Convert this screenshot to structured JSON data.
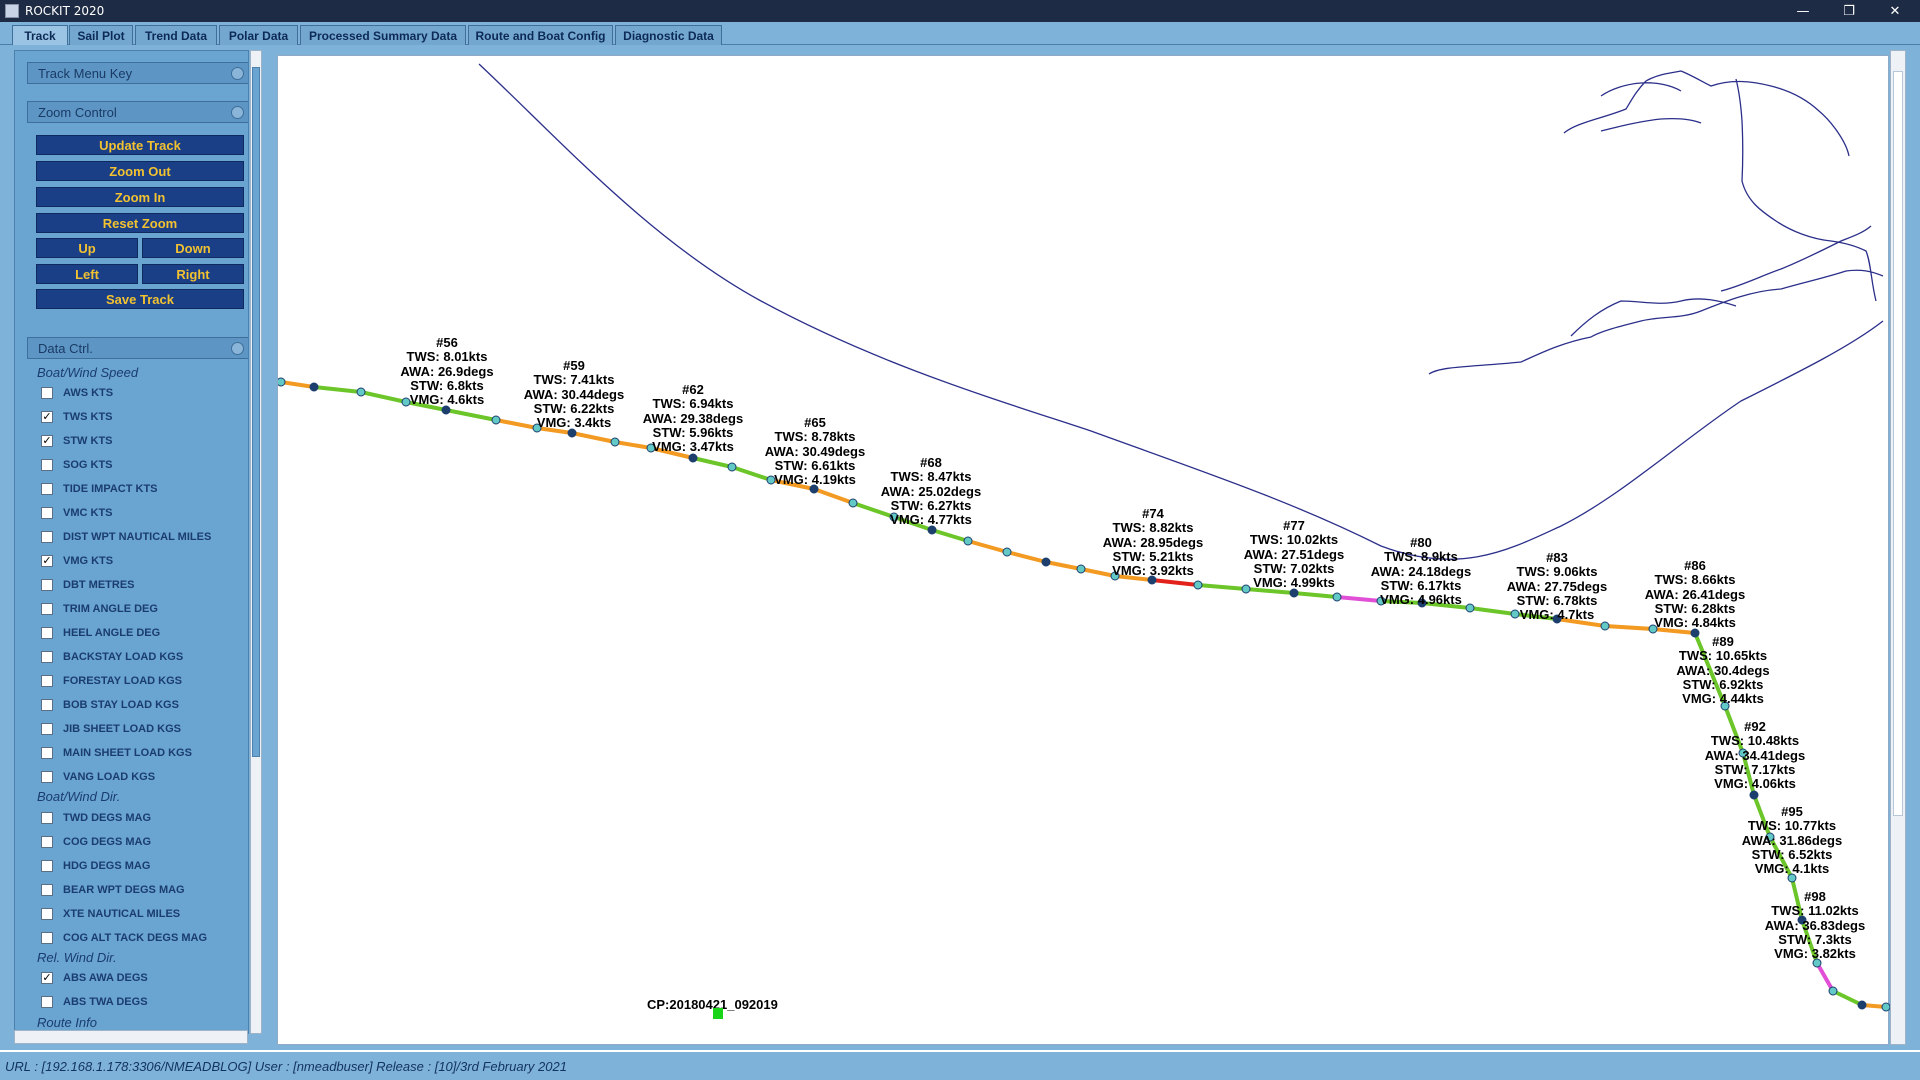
{
  "window": {
    "title": "ROCKIT 2020"
  },
  "tabs": [
    {
      "label": "Track",
      "active": true
    },
    {
      "label": "Sail Plot"
    },
    {
      "label": "Trend Data"
    },
    {
      "label": "Polar Data"
    },
    {
      "label": "Processed Summary Data"
    },
    {
      "label": "Route and Boat Config"
    },
    {
      "label": "Diagnostic Data"
    }
  ],
  "sidebar": {
    "track_menu_key": "Track Menu Key",
    "zoom_control": {
      "title": "Zoom Control",
      "update_track": "Update Track",
      "zoom_out": "Zoom Out",
      "zoom_in": "Zoom In",
      "reset_zoom": "Reset Zoom",
      "up": "Up",
      "down": "Down",
      "left": "Left",
      "right": "Right",
      "save_track": "Save Track"
    },
    "data_ctrl": {
      "title": "Data Ctrl.",
      "categories": [
        {
          "label": "Boat/Wind Speed",
          "items": [
            {
              "label": "AWS KTS",
              "checked": false
            },
            {
              "label": "TWS KTS",
              "checked": true
            },
            {
              "label": "STW KTS",
              "checked": true
            },
            {
              "label": "SOG KTS",
              "checked": false
            },
            {
              "label": "TIDE IMPACT KTS",
              "checked": false
            },
            {
              "label": "VMC KTS",
              "checked": false
            },
            {
              "label": "DIST WPT NAUTICAL MILES",
              "checked": false
            },
            {
              "label": "VMG KTS",
              "checked": true
            },
            {
              "label": "DBT METRES",
              "checked": false
            },
            {
              "label": "TRIM ANGLE DEG",
              "checked": false
            },
            {
              "label": "HEEL ANGLE DEG",
              "checked": false
            },
            {
              "label": "BACKSTAY LOAD KGS",
              "checked": false
            },
            {
              "label": "FORESTAY LOAD KGS",
              "checked": false
            },
            {
              "label": "BOB STAY LOAD KGS",
              "checked": false
            },
            {
              "label": "JIB SHEET LOAD KGS",
              "checked": false
            },
            {
              "label": "MAIN SHEET LOAD KGS",
              "checked": false
            },
            {
              "label": "VANG LOAD KGS",
              "checked": false
            }
          ]
        },
        {
          "label": "Boat/Wind Dir.",
          "items": [
            {
              "label": "TWD DEGS MAG",
              "checked": false
            },
            {
              "label": "COG DEGS MAG",
              "checked": false
            },
            {
              "label": "HDG DEGS MAG",
              "checked": false
            },
            {
              "label": "BEAR WPT DEGS MAG",
              "checked": false
            },
            {
              "label": "XTE NAUTICAL MILES",
              "checked": false
            },
            {
              "label": "COG ALT TACK DEGS MAG",
              "checked": false
            }
          ]
        },
        {
          "label": "Rel. Wind Dir.",
          "items": [
            {
              "label": "ABS AWA DEGS",
              "checked": true
            },
            {
              "label": "ABS TWA DEGS",
              "checked": false
            }
          ]
        }
      ],
      "cut_off": "Route Info"
    }
  },
  "map": {
    "checkpoint_label": "CP:20180421_092019",
    "segment_colors": {
      "green": "#6cc629",
      "orange": "#f29a22",
      "red": "#e3211b",
      "magenta": "#e04fd6"
    },
    "track": [
      [
        280,
        381
      ],
      [
        313,
        386
      ],
      [
        360,
        391
      ],
      [
        405,
        401
      ],
      [
        445,
        409
      ],
      [
        495,
        419
      ],
      [
        536,
        427
      ],
      [
        571,
        432
      ],
      [
        614,
        441
      ],
      [
        650,
        447
      ],
      [
        692,
        457
      ],
      [
        731,
        466
      ],
      [
        770,
        479
      ],
      [
        813,
        488
      ],
      [
        852,
        502
      ],
      [
        893,
        516
      ],
      [
        931,
        529
      ],
      [
        967,
        540
      ],
      [
        1006,
        551
      ],
      [
        1045,
        561
      ],
      [
        1080,
        568
      ],
      [
        1114,
        575
      ],
      [
        1151,
        579
      ],
      [
        1197,
        584
      ],
      [
        1245,
        588
      ],
      [
        1293,
        592
      ],
      [
        1336,
        596
      ],
      [
        1380,
        600
      ],
      [
        1421,
        602
      ],
      [
        1469,
        607
      ],
      [
        1514,
        613
      ],
      [
        1556,
        618
      ],
      [
        1604,
        625
      ],
      [
        1652,
        628
      ],
      [
        1694,
        632
      ],
      [
        1724,
        705
      ],
      [
        1742,
        752
      ],
      [
        1753,
        794
      ],
      [
        1769,
        836
      ],
      [
        1791,
        877
      ],
      [
        1801,
        919
      ],
      [
        1816,
        962
      ],
      [
        1832,
        990
      ],
      [
        1861,
        1004
      ],
      [
        1885,
        1006
      ]
    ],
    "segment_color_keys": [
      "orange",
      "green",
      "green",
      "green",
      "green",
      "orange",
      "orange",
      "orange",
      "orange",
      "orange",
      "green",
      "green",
      "orange",
      "orange",
      "green",
      "green",
      "green",
      "orange",
      "orange",
      "orange",
      "orange",
      "orange",
      "red",
      "green",
      "green",
      "green",
      "magenta",
      "green",
      "green",
      "green",
      "green",
      "orange",
      "orange",
      "orange",
      "green",
      "green",
      "green",
      "green",
      "green",
      "green",
      "green",
      "magenta",
      "green",
      "orange"
    ],
    "waypoint_labels": [
      {
        "id": "#56",
        "tws": "TWS: 8.01kts",
        "awa": "AWA: 26.9degs",
        "stw": "STW: 6.8kts",
        "vmg": "VMG: 4.6kts"
      },
      {
        "id": "#59",
        "tws": "TWS: 7.41kts",
        "awa": "AWA: 30.44degs",
        "stw": "STW: 6.22kts",
        "vmg": "VMG: 3.4kts"
      },
      {
        "id": "#62",
        "tws": "TWS: 6.94kts",
        "awa": "AWA: 29.38degs",
        "stw": "STW: 5.96kts",
        "vmg": "VMG: 3.47kts"
      },
      {
        "id": "#65",
        "tws": "TWS: 8.78kts",
        "awa": "AWA: 30.49degs",
        "stw": "STW: 6.61kts",
        "vmg": "VMG: 4.19kts"
      },
      {
        "id": "#68",
        "tws": "TWS: 8.47kts",
        "awa": "AWA: 25.02degs",
        "stw": "STW: 6.27kts",
        "vmg": "VMG: 4.77kts"
      },
      {
        "id": "#74",
        "tws": "TWS: 8.82kts",
        "awa": "AWA: 28.95degs",
        "stw": "STW: 5.21kts",
        "vmg": "VMG: 3.92kts"
      },
      {
        "id": "#77",
        "tws": "TWS: 10.02kts",
        "awa": "AWA: 27.51degs",
        "stw": "STW: 7.02kts",
        "vmg": "VMG: 4.99kts"
      },
      {
        "id": "#80",
        "tws": "TWS: 8.9kts",
        "awa": "AWA: 24.18degs",
        "stw": "STW: 6.17kts",
        "vmg": "VMG: 4.96kts"
      },
      {
        "id": "#83",
        "tws": "TWS: 9.06kts",
        "awa": "AWA: 27.75degs",
        "stw": "STW: 6.78kts",
        "vmg": "VMG: 4.7kts"
      },
      {
        "id": "#86",
        "tws": "TWS: 8.66kts",
        "awa": "AWA: 26.41degs",
        "stw": "STW: 6.28kts",
        "vmg": "VMG: 4.84kts"
      },
      {
        "id": "#89",
        "tws": "TWS: 10.65kts",
        "awa": "AWA: 30.4degs",
        "stw": "STW: 6.92kts",
        "vmg": "VMG: 4.44kts"
      },
      {
        "id": "#92",
        "tws": "TWS: 10.48kts",
        "awa": "AWA: 34.41degs",
        "stw": "STW: 7.17kts",
        "vmg": "VMG: 4.06kts"
      },
      {
        "id": "#95",
        "tws": "TWS: 10.77kts",
        "awa": "AWA: 31.86degs",
        "stw": "STW: 6.52kts",
        "vmg": "VMG: 4.1kts"
      },
      {
        "id": "#98",
        "tws": "TWS: 11.02kts",
        "awa": "AWA: 36.83degs",
        "stw": "STW: 7.3kts",
        "vmg": "VMG: 3.82kts"
      }
    ]
  },
  "status": {
    "text": "URL :  [192.168.1.178:3306/NMEADBLOG] User : [nmeadbuser] Release : [10]/3rd February 2021"
  }
}
